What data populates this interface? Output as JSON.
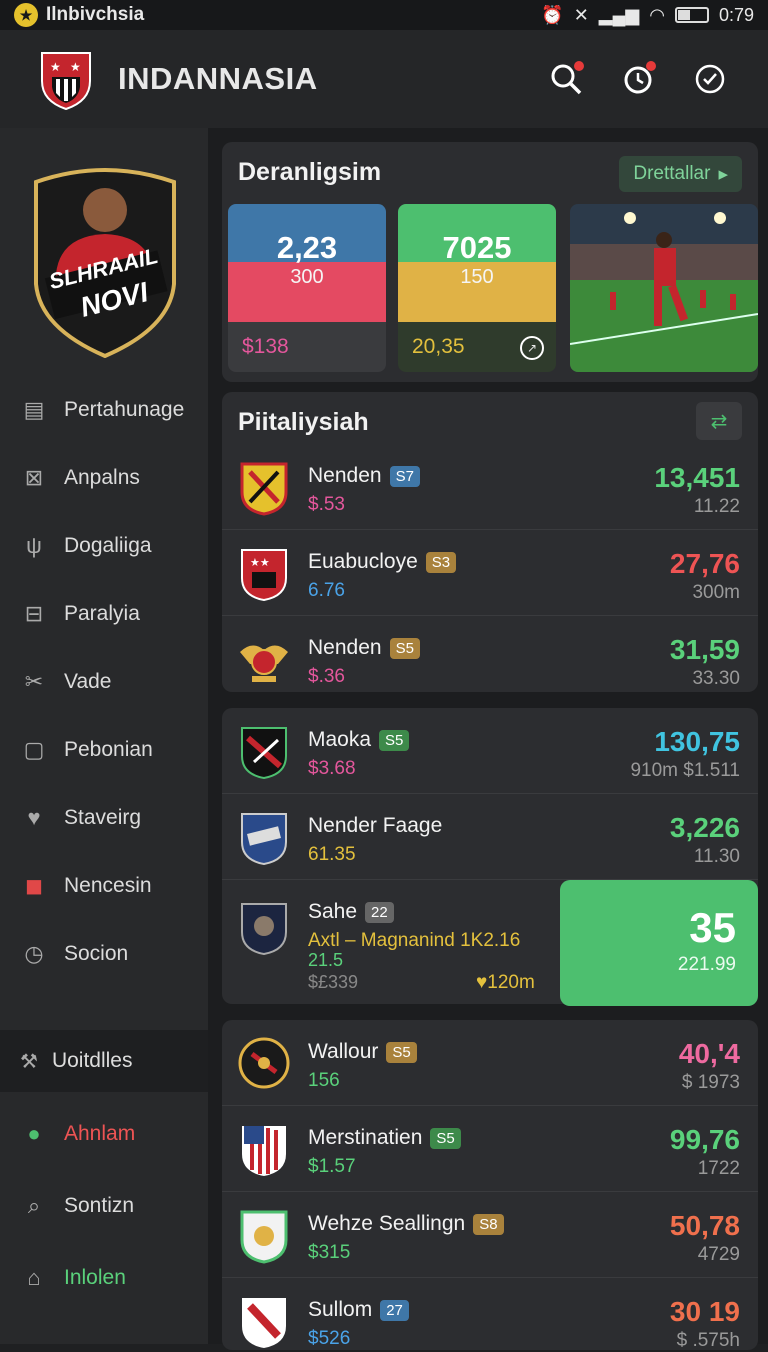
{
  "status": {
    "app": "Ilnbivchsia",
    "time": "0:79"
  },
  "header": {
    "title": "INDANNASIA"
  },
  "sidebar": {
    "profile_text_1": "SLHRAAIL",
    "profile_text_2": "NOVI",
    "items": [
      {
        "label": "Pertahunage",
        "icon": "card-icon"
      },
      {
        "label": "Anpalns",
        "icon": "grid-icon"
      },
      {
        "label": "Dogaliiga",
        "icon": "tulip-icon"
      },
      {
        "label": "Paralyia",
        "icon": "toolbox-icon"
      },
      {
        "label": "Vade",
        "icon": "scissors-icon"
      },
      {
        "label": "Pebonian",
        "icon": "chat-icon"
      },
      {
        "label": "Staveirg",
        "icon": "heart-icon"
      },
      {
        "label": "Nencesin",
        "icon": "bag-icon"
      },
      {
        "label": "Socion",
        "icon": "clock-icon"
      }
    ],
    "section": "Uoitdlles",
    "items2": [
      {
        "label": "Ahnlam",
        "icon": "ghost-icon"
      },
      {
        "label": "Sontizn",
        "icon": "search-doc-icon"
      },
      {
        "label": "Inlolen",
        "icon": "home-icon"
      }
    ]
  },
  "card1": {
    "title": "Deranligsim",
    "details_label": "Drettallar",
    "tile1": {
      "big": "2,23",
      "small": "300",
      "bottom": "$138"
    },
    "tile2": {
      "big": "7025",
      "small": "150",
      "bottom": "20,35"
    }
  },
  "card2": {
    "title": "Piitaliysiah",
    "rows": [
      {
        "name": "Nenden",
        "badge": "S7",
        "sub": "$.53",
        "val": "13,451",
        "val2": "11.22"
      },
      {
        "name": "Euabucloye",
        "badge": "S3",
        "sub": "6.76",
        "val": "27,76",
        "val2": "300m"
      },
      {
        "name": "Nenden",
        "badge": "S5",
        "sub": "$.36",
        "val": "31,59",
        "val2": "33.30"
      }
    ]
  },
  "card3": {
    "rows": [
      {
        "name": "Maoka",
        "badge": "S5",
        "sub": "$3.68",
        "val": "130,75",
        "val2": "910m $1.511"
      },
      {
        "name": "Nender Faage",
        "sub": "61.35",
        "val": "3,226",
        "val2": "11.30"
      },
      {
        "name": "Sahe",
        "badge": "22",
        "sub": "Axtl – Magnanind 1K2.16",
        "sub2": "21.5",
        "sub3": "$£339",
        "sub4": "120m",
        "val": "35",
        "val2": "221.99"
      }
    ]
  },
  "card4": {
    "rows": [
      {
        "name": "Wallour",
        "badge": "S5",
        "sub": "156",
        "val": "40,'4",
        "val2": "$ 1973"
      },
      {
        "name": "Merstinatien",
        "badge": "S5",
        "sub": "$1.57",
        "val": "99,76",
        "val2": "1722"
      },
      {
        "name": "Wehze Seallingn",
        "badge": "S8",
        "sub": "$315",
        "val": "50,78",
        "val2": "4729"
      },
      {
        "name": "Sullom",
        "badge": "27",
        "sub": "$526",
        "val": "30 19",
        "val2": "$ .575h"
      }
    ]
  }
}
